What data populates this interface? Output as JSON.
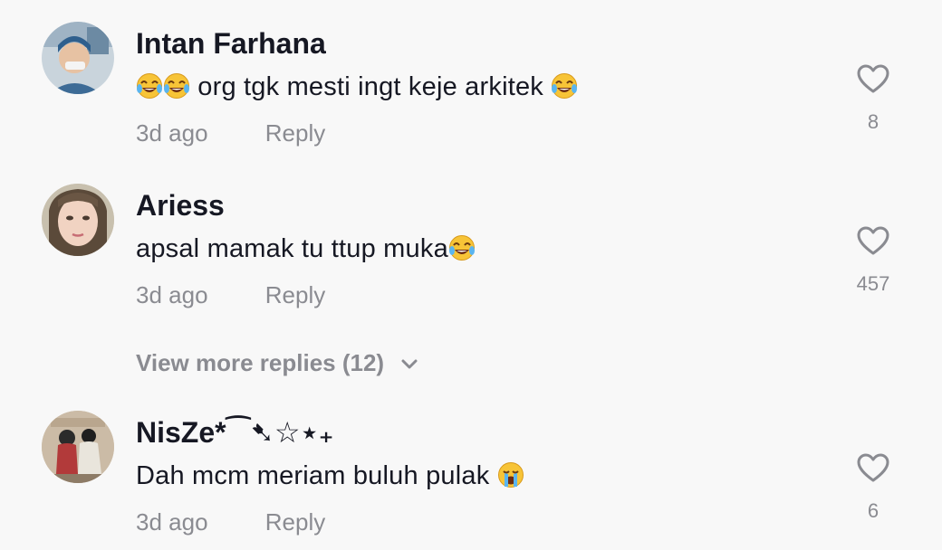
{
  "comments": [
    {
      "username": "Intan Farhana",
      "text_before": "",
      "text_middle": " org tgk mesti ingt keje arkitek ",
      "emoji_before": [
        "face-with-tears-of-joy",
        "face-with-tears-of-joy"
      ],
      "emoji_after": [
        "face-with-tears-of-joy"
      ],
      "time": "3d ago",
      "reply_label": "Reply",
      "likes": "8"
    },
    {
      "username": "Ariess",
      "text_middle": "apsal mamak tu ttup muka",
      "emoji_after": [
        "face-with-tears-of-joy"
      ],
      "time": "3d ago",
      "reply_label": "Reply",
      "likes": "457"
    },
    {
      "username": "NisZe*⁀➷☆⋆₊",
      "text_middle": "Dah mcm meriam buluh pulak ",
      "emoji_after": [
        "loudly-crying-face"
      ],
      "time": "3d ago",
      "reply_label": "Reply",
      "likes": "6"
    }
  ],
  "view_more_replies": "View more replies (12)",
  "colors": {
    "background": "#f8f8f8",
    "primary_text": "#161823",
    "secondary_text": "#8a8b91"
  }
}
